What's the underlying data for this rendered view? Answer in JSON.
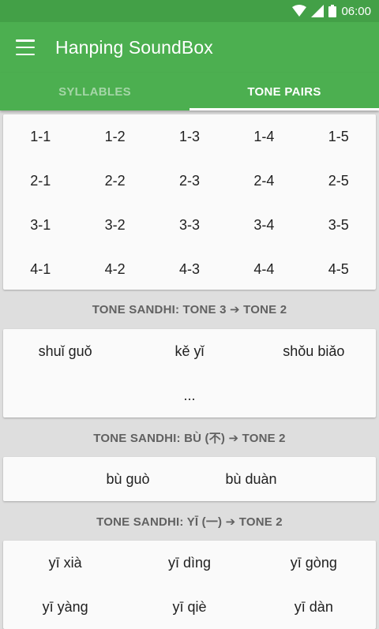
{
  "status_bar": {
    "time": "06:00"
  },
  "app_bar": {
    "title": "Hanping SoundBox"
  },
  "tabs": [
    {
      "label": "SYLLABLES",
      "active": false
    },
    {
      "label": "TONE PAIRS",
      "active": true
    }
  ],
  "tone_pairs": [
    [
      "1-1",
      "1-2",
      "1-3",
      "1-4",
      "1-5"
    ],
    [
      "2-1",
      "2-2",
      "2-3",
      "2-4",
      "2-5"
    ],
    [
      "3-1",
      "3-2",
      "3-3",
      "3-4",
      "3-5"
    ],
    [
      "4-1",
      "4-2",
      "4-3",
      "4-4",
      "4-5"
    ]
  ],
  "sandhi_tone3": {
    "title": "TONE SANDHI: TONE 3 ➔ TONE 2",
    "words": [
      "shuǐ guǒ",
      "kě yǐ",
      "shǒu biǎo"
    ],
    "more": "..."
  },
  "sandhi_bu": {
    "title": "TONE SANDHI: BÙ (不) ➔ TONE 2",
    "words": [
      "bù guò",
      "bù duàn"
    ]
  },
  "sandhi_yi": {
    "title": "TONE SANDHI: YĪ (一) ➔ TONE 2",
    "words": [
      "yī xià",
      "yī dìng",
      "yī gòng",
      "yī yàng",
      "yī qiè",
      "yī dàn"
    ]
  },
  "colors": {
    "status_bar": "#43a047",
    "app_bar": "#4caf50",
    "tab_inactive": "#a5d6a7",
    "background": "#dedede",
    "card": "#fafafa",
    "section_title": "#616161"
  }
}
